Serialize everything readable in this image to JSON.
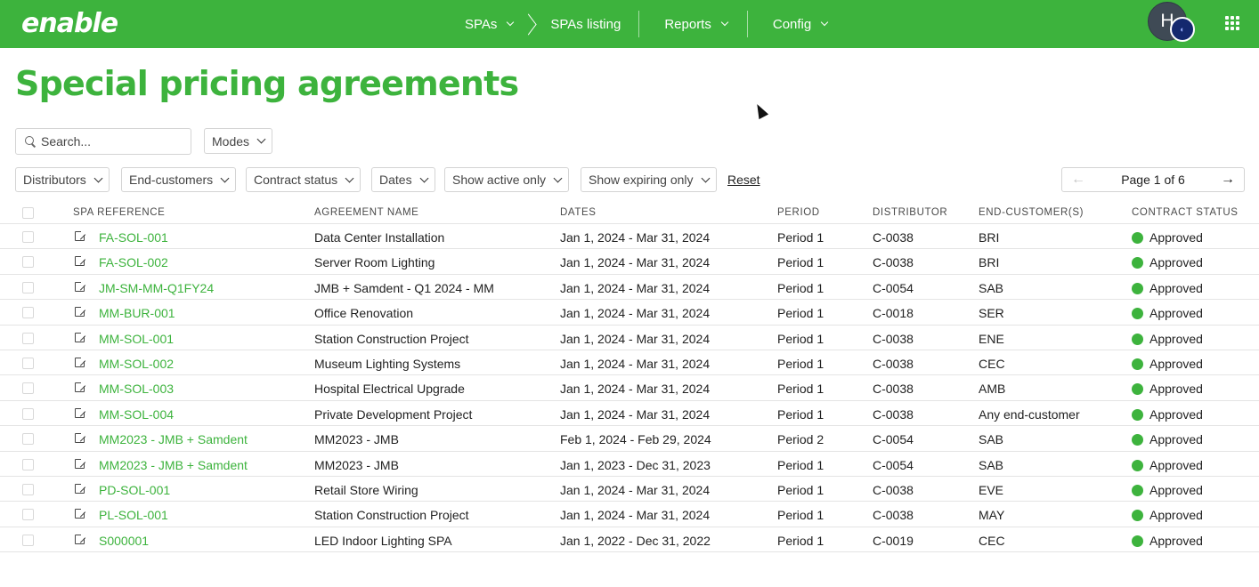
{
  "app": {
    "logo_text": "enable",
    "brand_color": "#3db33d"
  },
  "nav": {
    "spas_label": "SPAs",
    "listing_label": "SPAs listing",
    "reports_label": "Reports",
    "config_label": "Config",
    "avatar_initial": "H"
  },
  "page": {
    "title": "Special pricing agreements"
  },
  "search": {
    "placeholder": "Search...",
    "value": ""
  },
  "filters": {
    "modes": "Modes",
    "distributors": "Distributors",
    "end_customers": "End-customers",
    "contract_status": "Contract status",
    "dates": "Dates",
    "show_active": "Show active only",
    "show_expiring": "Show expiring only",
    "reset": "Reset"
  },
  "pager": {
    "label": "Page 1 of 6"
  },
  "table": {
    "headers": {
      "ref": "SPA REFERENCE",
      "name": "AGREEMENT NAME",
      "dates": "DATES",
      "period": "PERIOD",
      "distributor": "DISTRIBUTOR",
      "end_customers": "END-CUSTOMER(S)",
      "status": "CONTRACT STATUS"
    },
    "rows": [
      {
        "ref": "FA-SOL-001",
        "name": "Data Center Installation",
        "dates": "Jan 1, 2024 - Mar 31, 2024",
        "period": "Period 1",
        "distributor": "C-0038",
        "end": "BRI",
        "status": "Approved"
      },
      {
        "ref": "FA-SOL-002",
        "name": "Server Room Lighting",
        "dates": "Jan 1, 2024 - Mar 31, 2024",
        "period": "Period 1",
        "distributor": "C-0038",
        "end": "BRI",
        "status": "Approved"
      },
      {
        "ref": "JM-SM-MM-Q1FY24",
        "name": "JMB + Samdent - Q1 2024 - MM",
        "dates": "Jan 1, 2024 - Mar 31, 2024",
        "period": "Period 1",
        "distributor": "C-0054",
        "end": "SAB",
        "status": "Approved"
      },
      {
        "ref": "MM-BUR-001",
        "name": "Office Renovation",
        "dates": "Jan 1, 2024 - Mar 31, 2024",
        "period": "Period 1",
        "distributor": "C-0018",
        "end": "SER",
        "status": "Approved"
      },
      {
        "ref": "MM-SOL-001",
        "name": "Station Construction Project",
        "dates": "Jan 1, 2024 - Mar 31, 2024",
        "period": "Period 1",
        "distributor": "C-0038",
        "end": "ENE",
        "status": "Approved"
      },
      {
        "ref": "MM-SOL-002",
        "name": "Museum Lighting Systems",
        "dates": "Jan 1, 2024 - Mar 31, 2024",
        "period": "Period 1",
        "distributor": "C-0038",
        "end": "CEC",
        "status": "Approved"
      },
      {
        "ref": "MM-SOL-003",
        "name": "Hospital Electrical Upgrade",
        "dates": "Jan 1, 2024 - Mar 31, 2024",
        "period": "Period 1",
        "distributor": "C-0038",
        "end": "AMB",
        "status": "Approved"
      },
      {
        "ref": "MM-SOL-004",
        "name": "Private Development Project",
        "dates": "Jan 1, 2024 - Mar 31, 2024",
        "period": "Period 1",
        "distributor": "C-0038",
        "end": "Any end-customer",
        "status": "Approved"
      },
      {
        "ref": "MM2023 - JMB + Samdent",
        "name": "MM2023 - JMB",
        "dates": "Feb 1, 2024 - Feb 29, 2024",
        "period": "Period 2",
        "distributor": "C-0054",
        "end": "SAB",
        "status": "Approved"
      },
      {
        "ref": "MM2023 - JMB + Samdent",
        "name": "MM2023 - JMB",
        "dates": "Jan 1, 2023 - Dec 31, 2023",
        "period": "Period 1",
        "distributor": "C-0054",
        "end": "SAB",
        "status": "Approved"
      },
      {
        "ref": "PD-SOL-001",
        "name": "Retail Store Wiring",
        "dates": "Jan 1, 2024 - Mar 31, 2024",
        "period": "Period 1",
        "distributor": "C-0038",
        "end": "EVE",
        "status": "Approved"
      },
      {
        "ref": "PL-SOL-001",
        "name": "Station Construction Project",
        "dates": "Jan 1, 2024 - Mar 31, 2024",
        "period": "Period 1",
        "distributor": "C-0038",
        "end": "MAY",
        "status": "Approved"
      },
      {
        "ref": "S000001",
        "name": "LED Indoor Lighting SPA",
        "dates": "Jan 1, 2022 - Dec 31, 2022",
        "period": "Period 1",
        "distributor": "C-0019",
        "end": "CEC",
        "status": "Approved"
      }
    ]
  }
}
